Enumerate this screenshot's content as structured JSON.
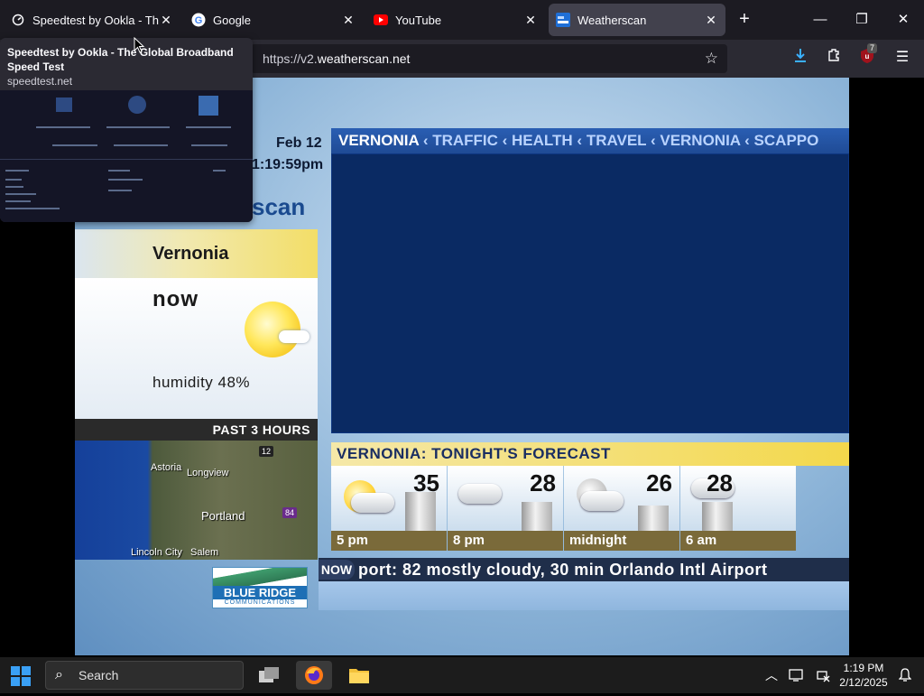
{
  "browser": {
    "tabs": [
      {
        "title": "Speedtest by Ookla - The Global Broadband Speed Test",
        "icon": "speedtest-icon"
      },
      {
        "title": "Google",
        "icon": "google-icon"
      },
      {
        "title": "YouTube",
        "icon": "youtube-icon"
      },
      {
        "title": "Weatherscan",
        "icon": "weatherscan-icon"
      }
    ],
    "active_tab": 3,
    "url_prefix": "https://v2.",
    "url_host": "weatherscan.net",
    "extension_badge": "7",
    "tooltip": {
      "title": "Speedtest by Ookla - The Global Broadband Speed Test",
      "url": "speedtest.net"
    }
  },
  "weatherscan": {
    "date": "Feb 12",
    "time": "1:19:59pm",
    "brand_partial": "scan",
    "top_ticker": {
      "first": "VERNONIA",
      "rest": " ‹ TRAFFIC ‹ HEALTH ‹ TRAVEL ‹ VERNONIA ‹ SCAPPO"
    },
    "current": {
      "location": "Vernonia",
      "label": "now",
      "humidity": "humidity 48%",
      "icon": "mostly-sunny-icon"
    },
    "past_hours_label": "PAST 3 HOURS",
    "map_labels": {
      "astoria": "Astoria",
      "longview": "Longview",
      "portland": "Portland",
      "lincoln_city": "Lincoln City",
      "salem": "Salem",
      "shield_12": "12",
      "shield_84": "84"
    },
    "forecast": {
      "heading": "VERNONIA:   TONIGHT'S FORECAST",
      "periods": [
        {
          "label": "5 pm",
          "temp": "35",
          "icon": "partly-cloudy-icon",
          "level": 0.62
        },
        {
          "label": "8 pm",
          "temp": "28",
          "icon": "cloudy-icon",
          "level": 0.45
        },
        {
          "label": "midnight",
          "temp": "26",
          "icon": "cloudy-night-icon",
          "level": 0.4
        },
        {
          "label": "6 am",
          "temp": "28",
          "icon": "cloudy-icon",
          "level": 0.45
        }
      ]
    },
    "crawl": {
      "badge": "NOW",
      "text": "port: 82 mostly cloudy, 30 min    Orlando Intl Airport"
    },
    "sponsor": {
      "line1": "BLUE RIDGE",
      "line2": "COMMUNICATIONS"
    }
  },
  "taskbar": {
    "search_label": "Search",
    "time": "1:19 PM",
    "date": "2/12/2025"
  }
}
